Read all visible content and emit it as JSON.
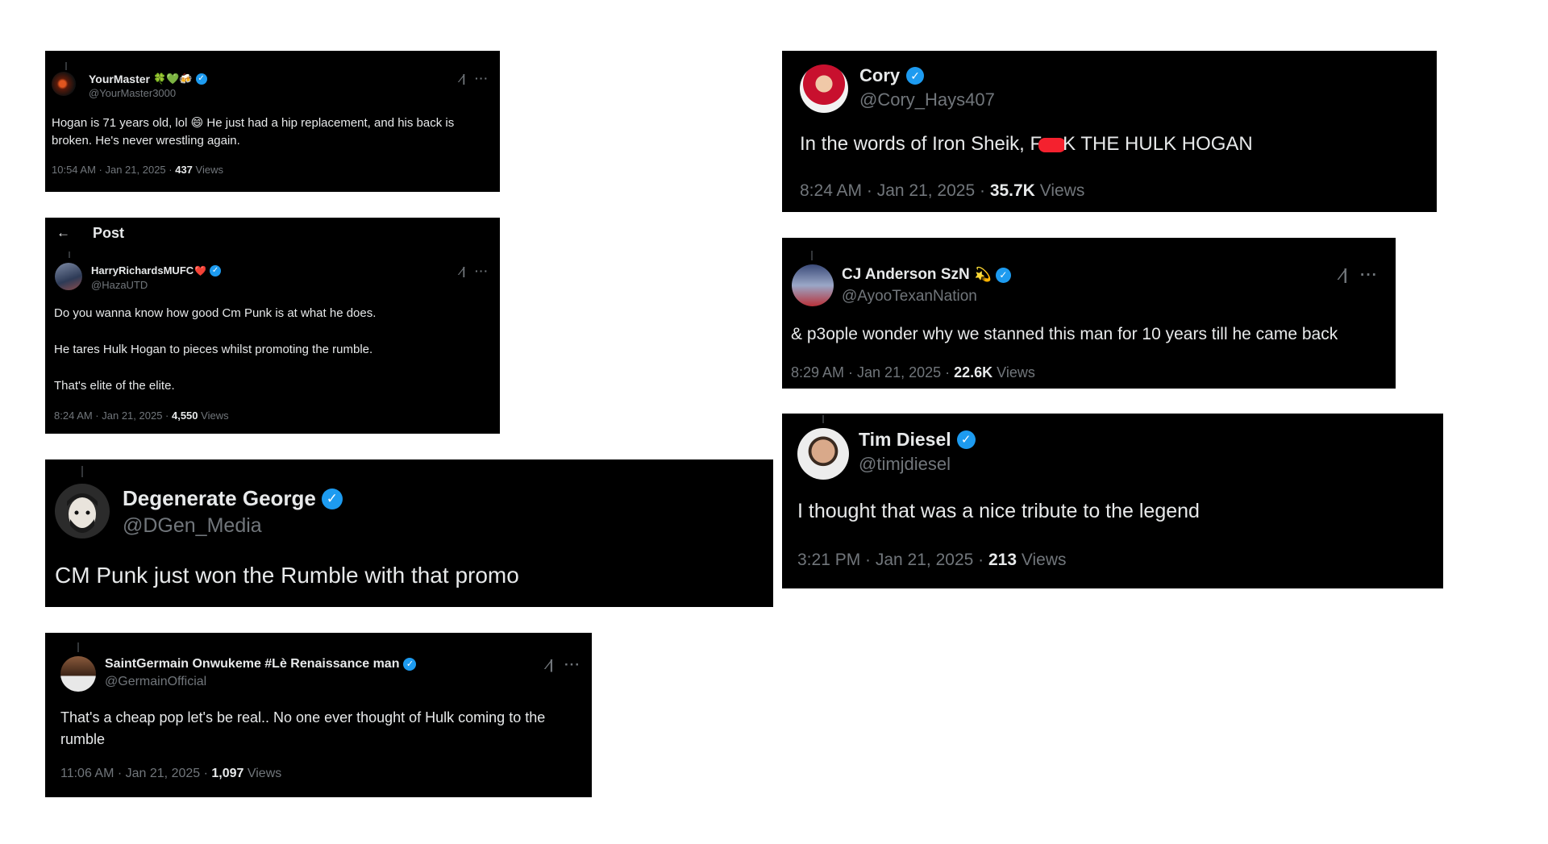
{
  "tweets": {
    "yourmaster": {
      "name": "YourMaster",
      "emoji": "🍀💚🍻",
      "handle": "@YourMaster3000",
      "text": "Hogan is 71 years old, lol 😄 He just had a hip replacement, and his back is broken. He's never wrestling again.",
      "time": "10:54 AM · Jan 21, 2025 · ",
      "views_count": "437",
      "views_label": " Views"
    },
    "harry": {
      "header_title": "Post",
      "name": "HarryRichardsMUFC",
      "emoji": "❤️",
      "handle": "@HazaUTD",
      "text_lines": [
        "Do you wanna know how good Cm Punk is at what he does.",
        "He tares Hulk Hogan to pieces whilst promoting the rumble.",
        "That's elite of the elite."
      ],
      "time": "8:24 AM · Jan 21, 2025 · ",
      "views_count": "4,550",
      "views_label": " Views"
    },
    "george": {
      "name": "Degenerate George",
      "handle": "@DGen_Media",
      "text": "CM Punk just won the Rumble with that promo"
    },
    "saint": {
      "name": "SaintGermain Onwukeme #Lè Renaissance man",
      "handle": "@GermainOfficial",
      "text": "That's a cheap pop let's be real.. No one ever thought of Hulk coming to the rumble",
      "time": "11:06 AM · Jan 21, 2025 · ",
      "views_count": "1,097",
      "views_label": " Views"
    },
    "cory": {
      "name": "Cory",
      "handle": "@Cory_Hays407",
      "text_before": "In the words of Iron Sheik, F",
      "text_after": "K THE HULK HOGAN",
      "time": "8:24 AM · Jan 21, 2025 · ",
      "views_count": "35.7K",
      "views_label": " Views"
    },
    "cj": {
      "name": "CJ Anderson SzN",
      "emoji": "💫",
      "handle": "@AyooTexanNation",
      "text": "& p3ople wonder why we stanned this man for 10 years till he came back",
      "time": "8:29 AM · Jan 21, 2025 · ",
      "views_count": "22.6K",
      "views_label": " Views"
    },
    "tim": {
      "name": "Tim Diesel",
      "handle": "@timjdiesel",
      "text": "I thought that was a nice tribute to the legend",
      "time": "3:21 PM · Jan 21, 2025 · ",
      "views_count": "213",
      "views_label": " Views"
    }
  },
  "icons": {
    "verified": "✓",
    "grok": "⁄|",
    "more": "···",
    "back": "←"
  },
  "colors": {
    "card_bg": "#000000",
    "verified_blue": "#1d9bf0",
    "muted_text": "#71767b",
    "redaction": "#f4212e"
  }
}
